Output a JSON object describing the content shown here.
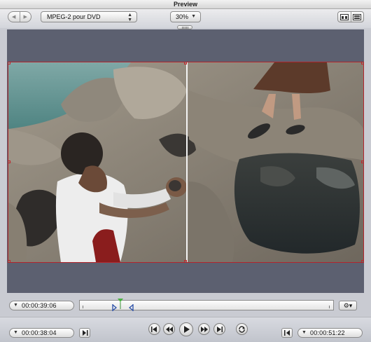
{
  "window": {
    "title": "Preview"
  },
  "toolbar": {
    "preset": "MPEG-2 pour DVD",
    "zoom": "30%"
  },
  "timeline": {
    "current_timecode": "00:00:39:06",
    "in_timecode": "00:00:38:04",
    "out_timecode": "00:00:51:22",
    "playhead_fraction": 0.16,
    "in_marker_fraction": 0.13,
    "out_marker_fraction": 0.21
  },
  "icons": {
    "back": "chevron-left-icon",
    "forward": "chevron-right-icon",
    "view_a": "split-view-icon",
    "view_b": "compare-view-icon",
    "action": "gear-icon",
    "go_to_in": "go-to-start-icon",
    "prev": "step-back-icon",
    "play": "play-icon",
    "next": "step-forward-icon",
    "go_to_out": "go-to-end-icon",
    "loop": "loop-icon",
    "mark_in": "mark-in-icon",
    "mark_out": "mark-out-icon"
  },
  "colors": {
    "canvas": "#5c6070",
    "frame_border": "#b3242c",
    "chrome": "#c9cbd2"
  }
}
